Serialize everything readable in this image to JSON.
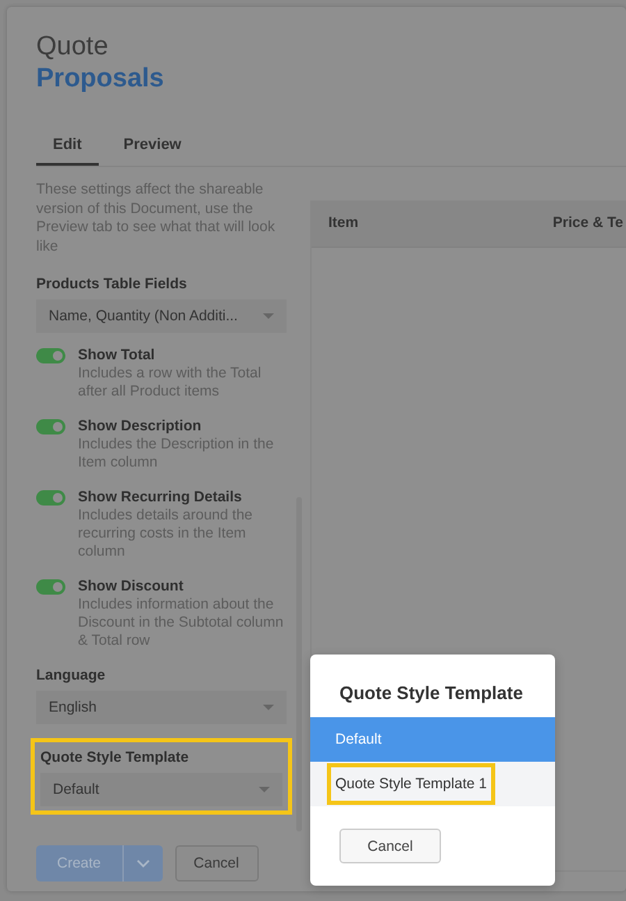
{
  "header": {
    "title": "Quote",
    "subtitle": "Proposals"
  },
  "tabs": [
    {
      "label": "Edit",
      "selected": true
    },
    {
      "label": "Preview",
      "selected": false
    }
  ],
  "intro": "These settings affect the shareable version of this Document, use the Preview tab to see what that will look like",
  "products_field": {
    "label": "Products Table Fields",
    "value": "Name, Quantity (Non Additi..."
  },
  "toggles": [
    {
      "title": "Show Total",
      "description": "Includes a row with the Total after all Product items",
      "on": true
    },
    {
      "title": "Show Description",
      "description": "Includes the Description in the Item column",
      "on": true
    },
    {
      "title": "Show Recurring Details",
      "description": "Includes details around the recurring costs in the Item column",
      "on": true
    },
    {
      "title": "Show Discount",
      "description": "Includes information about the Discount in the Subtotal column & Total row",
      "on": true
    }
  ],
  "language": {
    "label": "Language",
    "value": "English"
  },
  "template": {
    "label": "Quote Style Template",
    "value": "Default",
    "highlighted": true
  },
  "actions": {
    "create": "Create",
    "cancel": "Cancel"
  },
  "preview_table": {
    "columns": [
      "Item",
      "Price & Te"
    ]
  },
  "modal": {
    "title": "Quote Style Template",
    "cancel": "Cancel",
    "options": [
      {
        "label": "Default",
        "selected": true,
        "highlighted": false
      },
      {
        "label": "Quote Style Template 1",
        "selected": false,
        "highlighted": true
      }
    ]
  }
}
